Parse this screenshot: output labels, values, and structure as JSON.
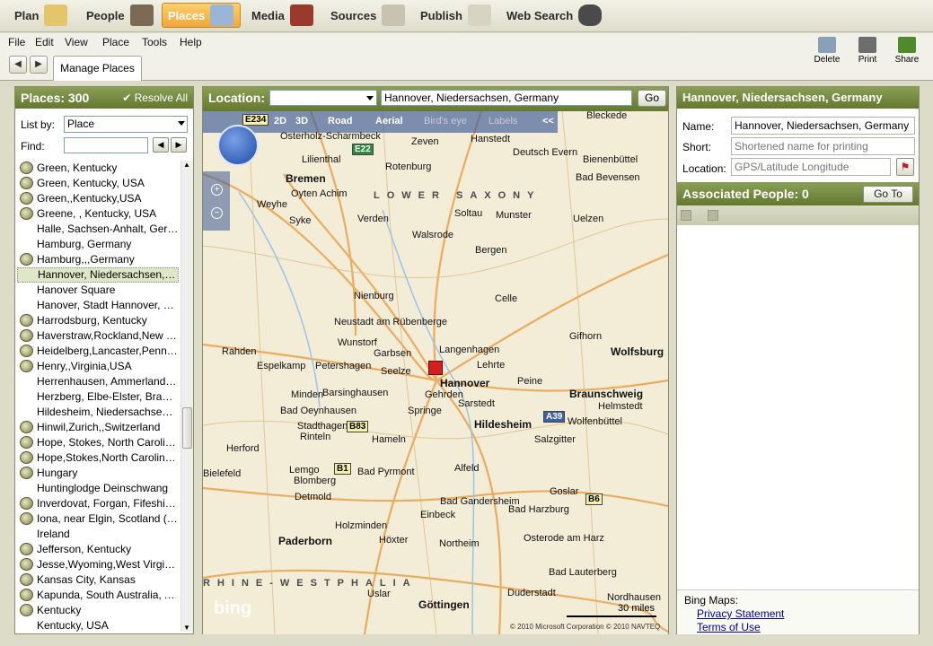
{
  "nav": {
    "items": [
      {
        "label": "Plan",
        "icon": "plan-icon"
      },
      {
        "label": "People",
        "icon": "people-icon"
      },
      {
        "label": "Places",
        "icon": "places-icon",
        "active": true
      },
      {
        "label": "Media",
        "icon": "media-icon"
      },
      {
        "label": "Sources",
        "icon": "sources-icon"
      },
      {
        "label": "Publish",
        "icon": "publish-icon"
      },
      {
        "label": "Web Search",
        "icon": "web-search-icon"
      }
    ]
  },
  "menu": [
    "File",
    "Edit",
    "View",
    "Place",
    "Tools",
    "Help"
  ],
  "toolbar": {
    "tab": "Manage Places",
    "delete": "Delete",
    "print": "Print",
    "share": "Share"
  },
  "left": {
    "title": "Places: 300",
    "resolve": "Resolve All",
    "list_by_label": "List by:",
    "list_by_value": "Place",
    "find_label": "Find:",
    "find_value": "",
    "places": [
      {
        "name": "Green, Kentucky",
        "resolved": true
      },
      {
        "name": "Green, Kentucky, USA",
        "resolved": true
      },
      {
        "name": "Green,,Kentucky,USA",
        "resolved": true
      },
      {
        "name": "Greene, , Kentucky, USA",
        "resolved": true
      },
      {
        "name": "Halle, Sachsen-Anhalt, Germany",
        "resolved": false
      },
      {
        "name": "Hamburg, Germany",
        "resolved": false
      },
      {
        "name": "Hamburg,,,Germany",
        "resolved": true
      },
      {
        "name": "Hannover, Niedersachsen, G...",
        "resolved": false,
        "selected": true
      },
      {
        "name": "Hanover Square",
        "resolved": false
      },
      {
        "name": "Hanover, Stadt Hannover, Nie...",
        "resolved": false
      },
      {
        "name": "Harrodsburg, Kentucky",
        "resolved": true
      },
      {
        "name": "Haverstraw,Rockland,New Yo...",
        "resolved": true
      },
      {
        "name": "Heidelberg,Lancaster,Pennsyl...",
        "resolved": true
      },
      {
        "name": "Henry,,Virginia,USA",
        "resolved": true
      },
      {
        "name": "Herrenhausen, Ammerland, Ni...",
        "resolved": false
      },
      {
        "name": "Herzberg, Elbe-Elster, Branden...",
        "resolved": false
      },
      {
        "name": "Hildesheim, Niedersachsen, G...",
        "resolved": false
      },
      {
        "name": "Hinwil,Zurich,,Switzerland",
        "resolved": true
      },
      {
        "name": "Hope, Stokes, North Carolina, ...",
        "resolved": true
      },
      {
        "name": "Hope,Stokes,North Carolina,U...",
        "resolved": true
      },
      {
        "name": "Hungary",
        "resolved": true
      },
      {
        "name": "Huntinglodge Deinschwang",
        "resolved": false
      },
      {
        "name": "Inverdovat, Forgan, Fifeshire, ...",
        "resolved": true
      },
      {
        "name": "Iona, near Elgin, Scotland (kille...",
        "resolved": true
      },
      {
        "name": "Ireland",
        "resolved": false
      },
      {
        "name": "Jefferson, Kentucky",
        "resolved": true
      },
      {
        "name": "Jesse,Wyoming,West Virginia,...",
        "resolved": true
      },
      {
        "name": "Kansas City, Kansas",
        "resolved": true
      },
      {
        "name": "Kapunda, South Australia, Aus...",
        "resolved": true
      },
      {
        "name": "Kentucky",
        "resolved": true
      },
      {
        "name": "Kentucky, USA",
        "resolved": false
      }
    ]
  },
  "center": {
    "location_label": "Location:",
    "location_value": "Hannover, Niedersachsen, Germany",
    "go": "Go",
    "map_modes": {
      "d2": "2D",
      "d3": "3D",
      "road": "Road",
      "aerial": "Aerial",
      "birds_eye": "Bird's eye",
      "labels": "Labels",
      "collapse": "<<"
    },
    "bing": "bing",
    "scale": "30 miles",
    "copyright": "© 2010 Microsoft Corporation  © 2010 NAVTEQ",
    "labels": [
      "Bremen",
      "Osterholz-Scharmbeck",
      "Lilienthal",
      "Achim",
      "Oyten",
      "Weyhe",
      "Syke",
      "Verden",
      "Rotenburg",
      "Gehrden",
      "Zeven",
      "Hanstedt",
      "Bleckede",
      "Deutsch Evern",
      "Bienenbüttel",
      "Bad Bevensen",
      "Soltau",
      "Munster",
      "Uelzen",
      "Walsrode",
      "Bergen",
      "Celle",
      "Nienburg",
      "Neustadt am Rübenberge",
      "Garbsen",
      "Langenhagen",
      "Hannover",
      "Lehrte",
      "Peine",
      "Braunschweig",
      "Wolfsburg",
      "Wolfenbüttel",
      "Salzgitter",
      "Hildesheim",
      "Sarstedt",
      "Springe",
      "Hameln",
      "Minden",
      "Bad Oeynhausen",
      "Herford",
      "Bielefeld",
      "Detmold",
      "Bad Pyrmont",
      "Holzminden",
      "Bad Gandersheim",
      "Einbeck",
      "Northeim",
      "Göttingen",
      "Duderstadt",
      "Osterode am Harz",
      "Bad Harzburg",
      "Goslar",
      "Paderborn",
      "Höxter",
      "Bad Lauterberg",
      "Nordhausen",
      "Helmstedt",
      "Gifhorn",
      "Lower Saxony",
      "Rhine-Westphalia",
      "Petershagen",
      "Espelkamp",
      "Barsinghausen",
      "Seelze",
      "Wunstorf",
      "Rahden",
      "Stadthagen",
      "Alfeld",
      "Uslar",
      "Rinteln",
      "Lemgo",
      "Blomberg"
    ],
    "roads": [
      "E234",
      "E22",
      "B83",
      "B1",
      "A39",
      "B6"
    ]
  },
  "right": {
    "title": "Hannover, Niedersachsen, Germany",
    "name_label": "Name:",
    "name_value": "Hannover, Niedersachsen, Germany",
    "short_label": "Short:",
    "short_placeholder": "Shortened name for printing",
    "location_label": "Location:",
    "location_placeholder": "GPS/Latitude Longitude",
    "assoc_title": "Associated People: 0",
    "goto": "Go To",
    "bing_title": "Bing Maps:",
    "privacy": "Privacy Statement",
    "terms": "Terms of Use"
  },
  "colors": {
    "accent": "#6b8036",
    "active_tab": "#f2a63a",
    "link": "#00008b"
  }
}
